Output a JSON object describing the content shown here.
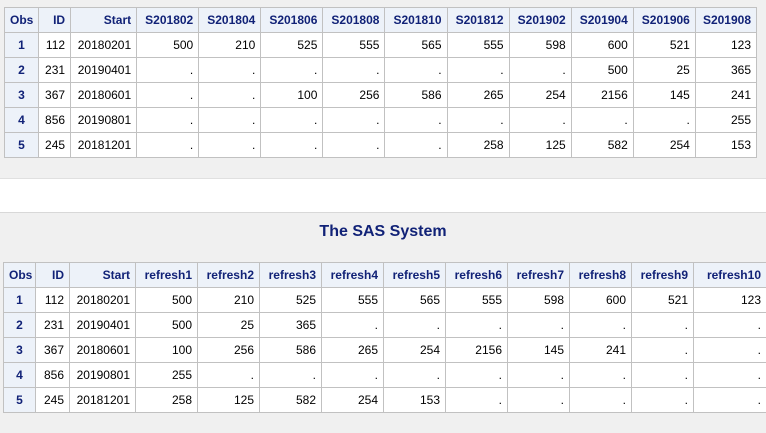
{
  "table1": {
    "headers": [
      "Obs",
      "ID",
      "Start",
      "S201802",
      "S201804",
      "S201806",
      "S201808",
      "S201810",
      "S201812",
      "S201902",
      "S201904",
      "S201906",
      "S201908"
    ],
    "rows": [
      [
        "1",
        "112",
        "20180201",
        "500",
        "210",
        "525",
        "555",
        "565",
        "555",
        "598",
        "600",
        "521",
        "123"
      ],
      [
        "2",
        "231",
        "20190401",
        ".",
        ".",
        ".",
        ".",
        ".",
        ".",
        ".",
        "500",
        "25",
        "365"
      ],
      [
        "3",
        "367",
        "20180601",
        ".",
        ".",
        "100",
        "256",
        "586",
        "265",
        "254",
        "2156",
        "145",
        "241"
      ],
      [
        "4",
        "856",
        "20190801",
        ".",
        ".",
        ".",
        ".",
        ".",
        ".",
        ".",
        ".",
        ".",
        "255"
      ],
      [
        "5",
        "245",
        "20181201",
        ".",
        ".",
        ".",
        ".",
        ".",
        "258",
        "125",
        "582",
        "254",
        "153"
      ]
    ]
  },
  "title": "The SAS System",
  "table2": {
    "headers": [
      "Obs",
      "ID",
      "Start",
      "refresh1",
      "refresh2",
      "refresh3",
      "refresh4",
      "refresh5",
      "refresh6",
      "refresh7",
      "refresh8",
      "refresh9",
      "refresh10"
    ],
    "rows": [
      [
        "1",
        "112",
        "20180201",
        "500",
        "210",
        "525",
        "555",
        "565",
        "555",
        "598",
        "600",
        "521",
        "123"
      ],
      [
        "2",
        "231",
        "20190401",
        "500",
        "25",
        "365",
        ".",
        ".",
        ".",
        ".",
        ".",
        ".",
        "."
      ],
      [
        "3",
        "367",
        "20180601",
        "100",
        "256",
        "586",
        "265",
        "254",
        "2156",
        "145",
        "241",
        ".",
        "."
      ],
      [
        "4",
        "856",
        "20190801",
        "255",
        ".",
        ".",
        ".",
        ".",
        ".",
        ".",
        ".",
        ".",
        "."
      ],
      [
        "5",
        "245",
        "20181201",
        "258",
        "125",
        "582",
        "254",
        "153",
        ".",
        ".",
        ".",
        ".",
        "."
      ]
    ]
  }
}
